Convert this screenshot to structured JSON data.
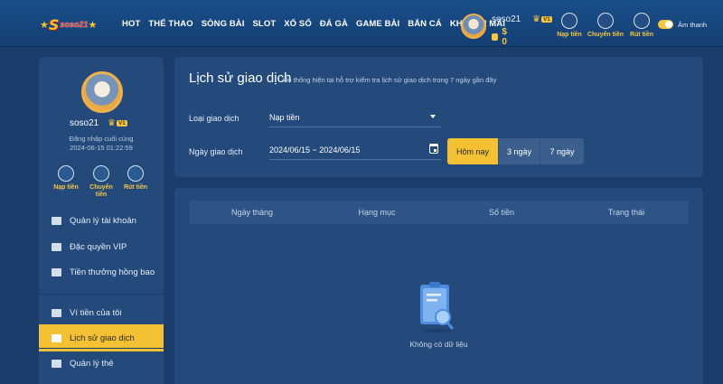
{
  "brand": {
    "logo_text": "S",
    "logo_word": "soso21"
  },
  "nav": {
    "items": [
      "HOT",
      "THỂ THAO",
      "SÒNG BÀI",
      "SLOT",
      "XỔ SỐ",
      "ĐÁ GÀ",
      "GAME BÀI",
      "BẮN CÁ",
      "KHUYẾN MÃI"
    ]
  },
  "user": {
    "name": "soso21",
    "vip": "V1",
    "balance": "$ 0"
  },
  "quick_actions": [
    {
      "label": "Nạp tiền",
      "icon": "deposit-icon"
    },
    {
      "label": "Chuyển tiền",
      "icon": "transfer-icon"
    },
    {
      "label": "Rút tiền",
      "icon": "withdraw-icon"
    }
  ],
  "sound": {
    "label": "Âm thanh",
    "on": true
  },
  "sidebar": {
    "name": "soso21",
    "vip": "V1",
    "last_login_label": "Đăng nhập cuối cùng",
    "last_login_time": "2024-06-15 01:22:59",
    "quick": [
      {
        "label": "Nạp tiền"
      },
      {
        "label": "Chuyển tiền"
      },
      {
        "label": "Rút tiền"
      }
    ],
    "menu": [
      {
        "label": "Quản lý tài khoản",
        "icon": "id-card-icon"
      },
      {
        "label": "Đặc quyền VIP",
        "icon": "crown-icon"
      },
      {
        "label": "Tiền thưởng hồng bao",
        "icon": "envelope-icon"
      },
      {
        "label": "Ví tiền của tôi",
        "icon": "wallet-icon"
      },
      {
        "label": "Lịch sử giao dịch",
        "icon": "document-icon",
        "active": true
      },
      {
        "label": "Quản lý thẻ",
        "icon": "card-icon"
      }
    ]
  },
  "history": {
    "title": "Lịch sử giao dịch",
    "subtitle": "Hệ thống hiện tại hỗ trợ kiểm tra lịch sử giao dịch trong 7 ngày gần đây",
    "type_label": "Loại giao dịch",
    "type_value": "Nạp tiền",
    "date_label": "Ngày giao dịch",
    "date_value": "2024/06/15 ~ 2024/06/15",
    "range_buttons": [
      "Hôm nay",
      "3 ngày",
      "7 ngày"
    ],
    "columns": [
      "Ngày tháng",
      "Hạng mục",
      "Số tiền",
      "Trạng thái"
    ],
    "empty_text": "Không có dữ liệu"
  },
  "colors": {
    "accent": "#f3c133",
    "panel": "#244a7b",
    "background": "#1b3d6b"
  }
}
